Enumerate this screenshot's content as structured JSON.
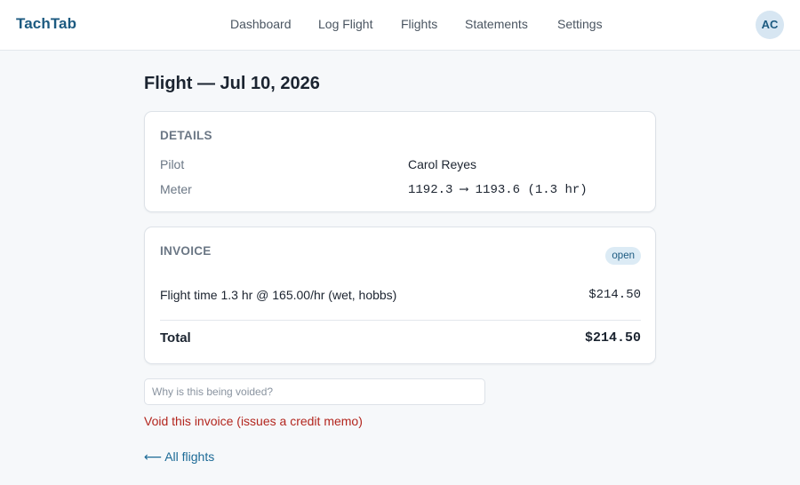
{
  "app": {
    "brand": "TachTab",
    "avatar_initials": "AC"
  },
  "nav": {
    "items": [
      {
        "label": "Dashboard"
      },
      {
        "label": "Log Flight"
      },
      {
        "label": "Flights"
      },
      {
        "label": "Statements"
      },
      {
        "label": "Settings"
      }
    ]
  },
  "page": {
    "title": "Flight — Jul 10, 2026"
  },
  "details": {
    "heading": "DETAILS",
    "rows": [
      {
        "label": "Pilot",
        "value": "Carol Reyes"
      },
      {
        "label": "Meter",
        "value": "1192.3 ⟶ 1193.6 (1.3 hr)"
      }
    ]
  },
  "invoice": {
    "heading": "INVOICE",
    "status": "open",
    "line_items": [
      {
        "description": "Flight time 1.3 hr @ 165.00/hr (wet, hobbs)",
        "amount": "$214.50"
      }
    ],
    "total_label": "Total",
    "total_amount": "$214.50"
  },
  "void": {
    "placeholder": "Why is this being voided?",
    "action_label": "Void this invoice (issues a credit memo)"
  },
  "back_link": "⟵ All flights",
  "colors": {
    "brand": "#1c5a80",
    "danger": "#b3261e",
    "link": "#1c6a96",
    "badge_bg": "#dcebf5"
  }
}
